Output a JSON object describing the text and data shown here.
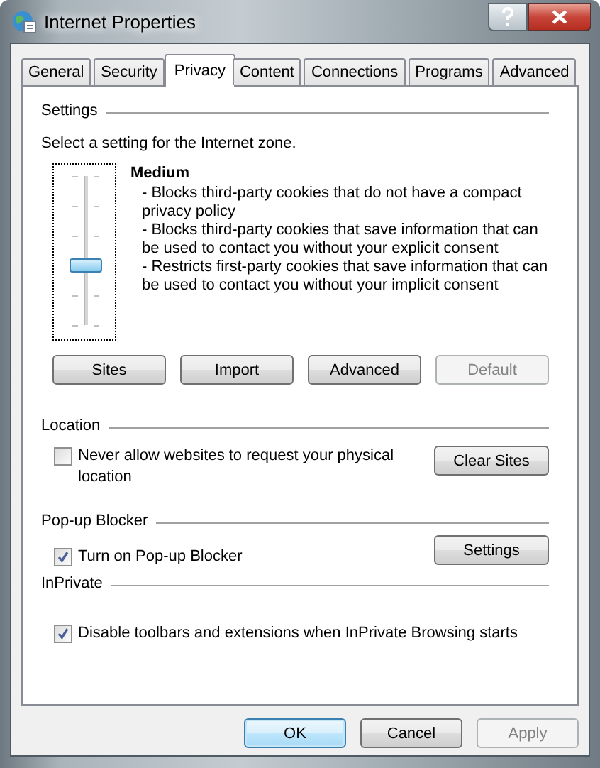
{
  "window": {
    "title": "Internet Properties"
  },
  "tabs": [
    {
      "label": "General",
      "selected": false
    },
    {
      "label": "Security",
      "selected": false
    },
    {
      "label": "Privacy",
      "selected": true
    },
    {
      "label": "Content",
      "selected": false
    },
    {
      "label": "Connections",
      "selected": false
    },
    {
      "label": "Programs",
      "selected": false
    },
    {
      "label": "Advanced",
      "selected": false
    }
  ],
  "settings": {
    "heading": "Settings",
    "prompt": "Select a setting for the Internet zone.",
    "slider": {
      "level": 0.4
    },
    "level_name": "Medium",
    "description": [
      "- Blocks third-party cookies that do not have a compact privacy policy",
      "- Blocks third-party cookies that save information that can be used to contact you without your explicit consent",
      "- Restricts first-party cookies that save information that can be used to contact you without your implicit consent"
    ],
    "buttons": [
      {
        "label": "Sites",
        "disabled": false
      },
      {
        "label": "Import",
        "disabled": false
      },
      {
        "label": "Advanced",
        "disabled": false
      },
      {
        "label": "Default",
        "disabled": true
      }
    ]
  },
  "location": {
    "heading": "Location",
    "checkbox": {
      "label": "Never allow websites to request your physical location",
      "checked": false
    },
    "button": {
      "label": "Clear Sites",
      "disabled": false
    }
  },
  "popup_blocker": {
    "heading": "Pop-up Blocker",
    "checkbox": {
      "label": "Turn on Pop-up Blocker",
      "checked": true
    },
    "button": {
      "label": "Settings",
      "disabled": false
    }
  },
  "inprivate": {
    "heading": "InPrivate",
    "checkbox": {
      "label": "Disable toolbars and extensions when InPrivate Browsing starts",
      "checked": true
    }
  },
  "dialog_buttons": [
    {
      "label": "OK",
      "default": true,
      "disabled": false
    },
    {
      "label": "Cancel",
      "default": false,
      "disabled": false
    },
    {
      "label": "Apply",
      "default": false,
      "disabled": true
    }
  ]
}
